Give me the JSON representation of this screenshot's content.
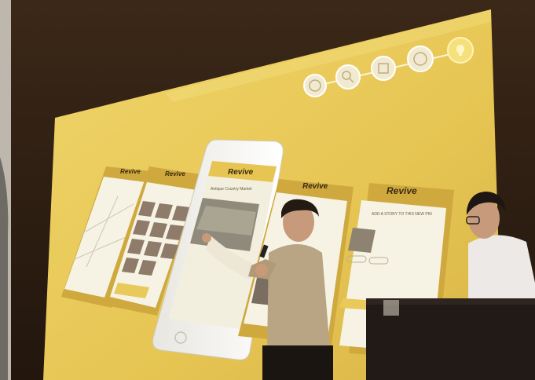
{
  "photo": {
    "description_tags": [
      "stage",
      "projection-screen",
      "presenter",
      "podium"
    ]
  },
  "screen": {
    "background_color": "#e8c95a",
    "brand": "Revive",
    "brand_on_title_screen": "Revive",
    "cards": [
      {
        "brand": "Revive"
      },
      {
        "brand": "Revive"
      },
      {
        "brand": "Revive"
      },
      {
        "brand": "Revive"
      },
      {
        "brand": "Revive"
      }
    ],
    "story_card_heading": "ADD A STORY TO THIS NEW PIN",
    "phone_location_label": "Antique Country Market"
  },
  "icons": [
    "globe-icon",
    "search-icon",
    "note-icon",
    "target-icon",
    "lightbulb-icon"
  ],
  "colors": {
    "screen_yellow": "#e9c95b",
    "wood_dark": "#2a1b10",
    "podium": "#201816",
    "card_white": "#f6f3e4",
    "shirt_beige": "#b9a584"
  }
}
